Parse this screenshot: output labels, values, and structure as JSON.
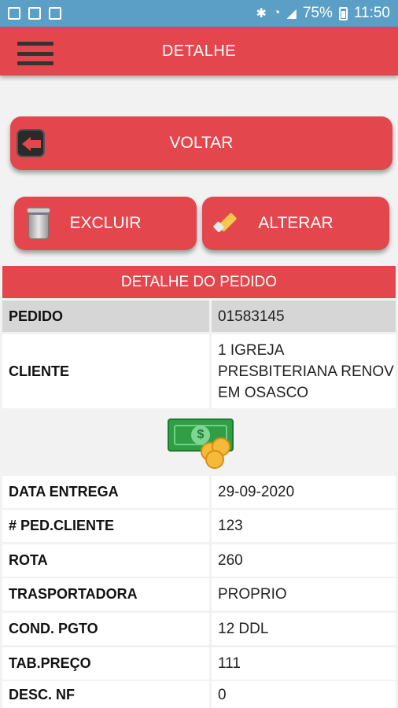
{
  "status_bar": {
    "battery": "75%",
    "time": "11:50"
  },
  "app_bar": {
    "title": "DETALHE"
  },
  "buttons": {
    "voltar": "VOLTAR",
    "excluir": "EXCLUIR",
    "alterar": "ALTERAR"
  },
  "section": {
    "title": "DETALHE DO PEDIDO"
  },
  "rows": [
    {
      "label": "PEDIDO",
      "value": "01583145"
    },
    {
      "label": "CLIENTE",
      "value": "1 IGREJA PRESBITERIANA RENOV EM OSASCO"
    },
    {
      "label": "DATA ENTREGA",
      "value": "29-09-2020"
    },
    {
      "label": "# PED.CLIENTE",
      "value": "123"
    },
    {
      "label": "ROTA",
      "value": "260"
    },
    {
      "label": "TRASPORTADORA",
      "value": "PROPRIO"
    },
    {
      "label": "COND. PGTO",
      "value": "12 DDL"
    },
    {
      "label": "TAB.PREÇO",
      "value": "111"
    },
    {
      "label": "DESC. NF",
      "value": "0"
    }
  ],
  "money_icon_symbol": "$",
  "colors": {
    "accent": "#e3474d",
    "status_bar": "#5c9fc6"
  }
}
